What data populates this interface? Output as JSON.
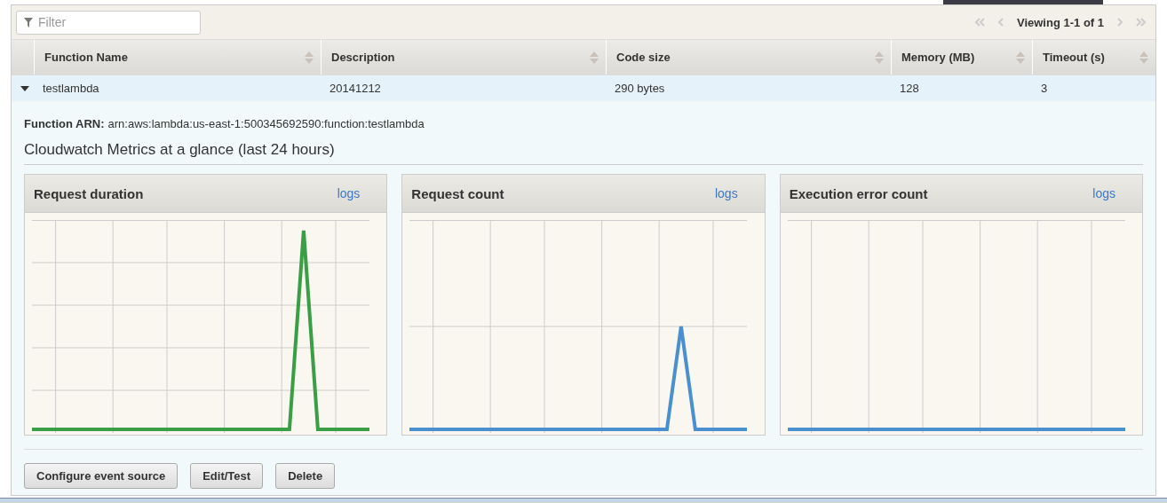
{
  "filter": {
    "placeholder": "Filter"
  },
  "pagination": {
    "label": "Viewing 1-1 of 1"
  },
  "table": {
    "columns": [
      "Function Name",
      "Description",
      "Code size",
      "Memory (MB)",
      "Timeout (s)"
    ],
    "rows": [
      {
        "expanded": true,
        "selected": true,
        "cells": [
          "testlambda",
          "20141212",
          "290 bytes",
          "128",
          "3"
        ]
      }
    ]
  },
  "details": {
    "arn_label": "Function ARN:",
    "arn": "arn:aws:lambda:us-east-1:500345692590:function:testlambda",
    "heading": "Cloudwatch Metrics at a glance (last 24 hours)",
    "panels": [
      {
        "title": "Request duration",
        "link": "logs",
        "color": "#3a9e47"
      },
      {
        "title": "Request count",
        "link": "logs",
        "color": "#4a8fd0"
      },
      {
        "title": "Execution error count",
        "link": "logs",
        "color": "#4a8fd0"
      }
    ],
    "buttons": [
      "Configure event source",
      "Edit/Test",
      "Delete"
    ]
  }
}
